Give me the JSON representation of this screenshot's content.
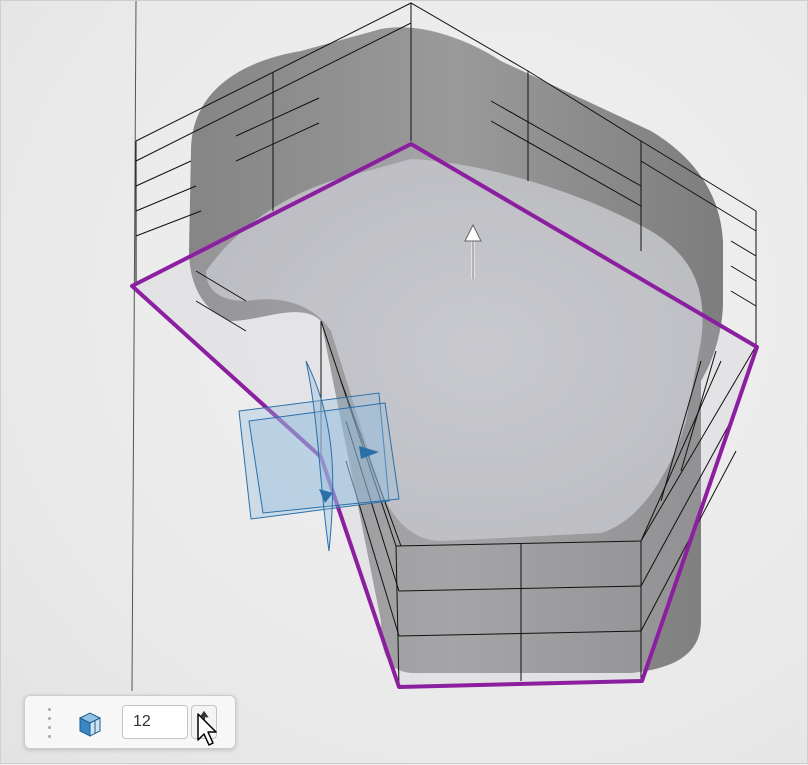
{
  "toolbar": {
    "count_value": "12",
    "icons": {
      "grip": "grip-dots-icon",
      "object": "box-icon",
      "spinner": "spinner-arrows-icon",
      "cursor": "mouse-pointer-icon"
    }
  },
  "colors": {
    "outline": "#8b1fa0",
    "solid_fill": "#8e8e8e",
    "floor_fill": "#c4c5c9",
    "wireframe": "#111111",
    "plane": "#2a6fa8",
    "background": "#ececec"
  }
}
